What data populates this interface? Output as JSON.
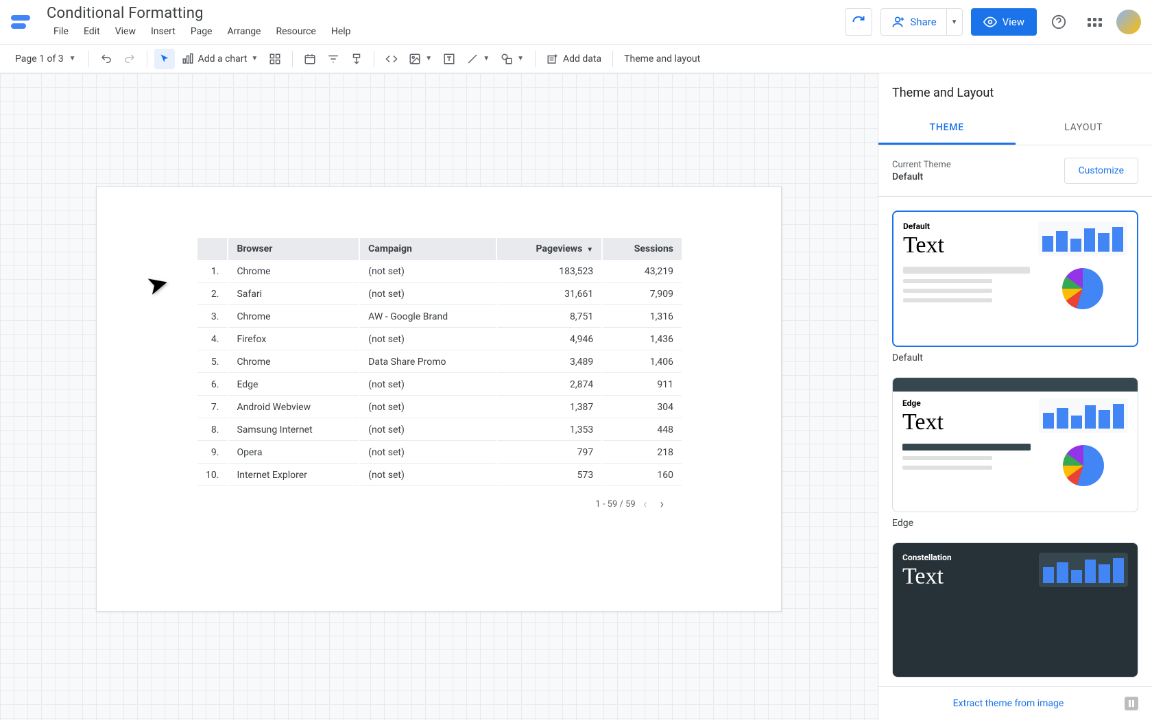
{
  "header": {
    "title": "Conditional Formatting",
    "menu": [
      "File",
      "Edit",
      "View",
      "Insert",
      "Page",
      "Arrange",
      "Resource",
      "Help"
    ],
    "share": "Share",
    "view": "View"
  },
  "toolbar": {
    "page_label": "Page 1 of 3",
    "add_chart": "Add a chart",
    "add_data": "Add data",
    "theme_layout": "Theme and layout"
  },
  "table": {
    "headers": [
      "Browser",
      "Campaign",
      "Pageviews",
      "Sessions"
    ],
    "sort_col": "Pageviews",
    "rows": [
      {
        "idx": "1.",
        "browser": "Chrome",
        "campaign": "(not set)",
        "pageviews": "183,523",
        "sessions": "43,219"
      },
      {
        "idx": "2.",
        "browser": "Safari",
        "campaign": "(not set)",
        "pageviews": "31,661",
        "sessions": "7,909"
      },
      {
        "idx": "3.",
        "browser": "Chrome",
        "campaign": "AW - Google Brand",
        "pageviews": "8,751",
        "sessions": "1,316"
      },
      {
        "idx": "4.",
        "browser": "Firefox",
        "campaign": "(not set)",
        "pageviews": "4,946",
        "sessions": "1,436"
      },
      {
        "idx": "5.",
        "browser": "Chrome",
        "campaign": "Data Share Promo",
        "pageviews": "3,489",
        "sessions": "1,406"
      },
      {
        "idx": "6.",
        "browser": "Edge",
        "campaign": "(not set)",
        "pageviews": "2,874",
        "sessions": "911"
      },
      {
        "idx": "7.",
        "browser": "Android Webview",
        "campaign": "(not set)",
        "pageviews": "1,387",
        "sessions": "304"
      },
      {
        "idx": "8.",
        "browser": "Samsung Internet",
        "campaign": "(not set)",
        "pageviews": "1,353",
        "sessions": "448"
      },
      {
        "idx": "9.",
        "browser": "Opera",
        "campaign": "(not set)",
        "pageviews": "797",
        "sessions": "218"
      },
      {
        "idx": "10.",
        "browser": "Internet Explorer",
        "campaign": "(not set)",
        "pageviews": "573",
        "sessions": "160"
      }
    ],
    "pagination": "1 - 59 / 59"
  },
  "panel": {
    "title": "Theme and Layout",
    "tabs": [
      "THEME",
      "LAYOUT"
    ],
    "current_label": "Current Theme",
    "current_name": "Default",
    "customize": "Customize",
    "themes": [
      {
        "name": "Default",
        "mini": "Default",
        "big": "Text"
      },
      {
        "name": "Edge",
        "mini": "Edge",
        "big": "Text"
      },
      {
        "name": "Constellation",
        "mini": "Constellation",
        "big": "Text"
      }
    ],
    "extract": "Extract theme from image"
  }
}
